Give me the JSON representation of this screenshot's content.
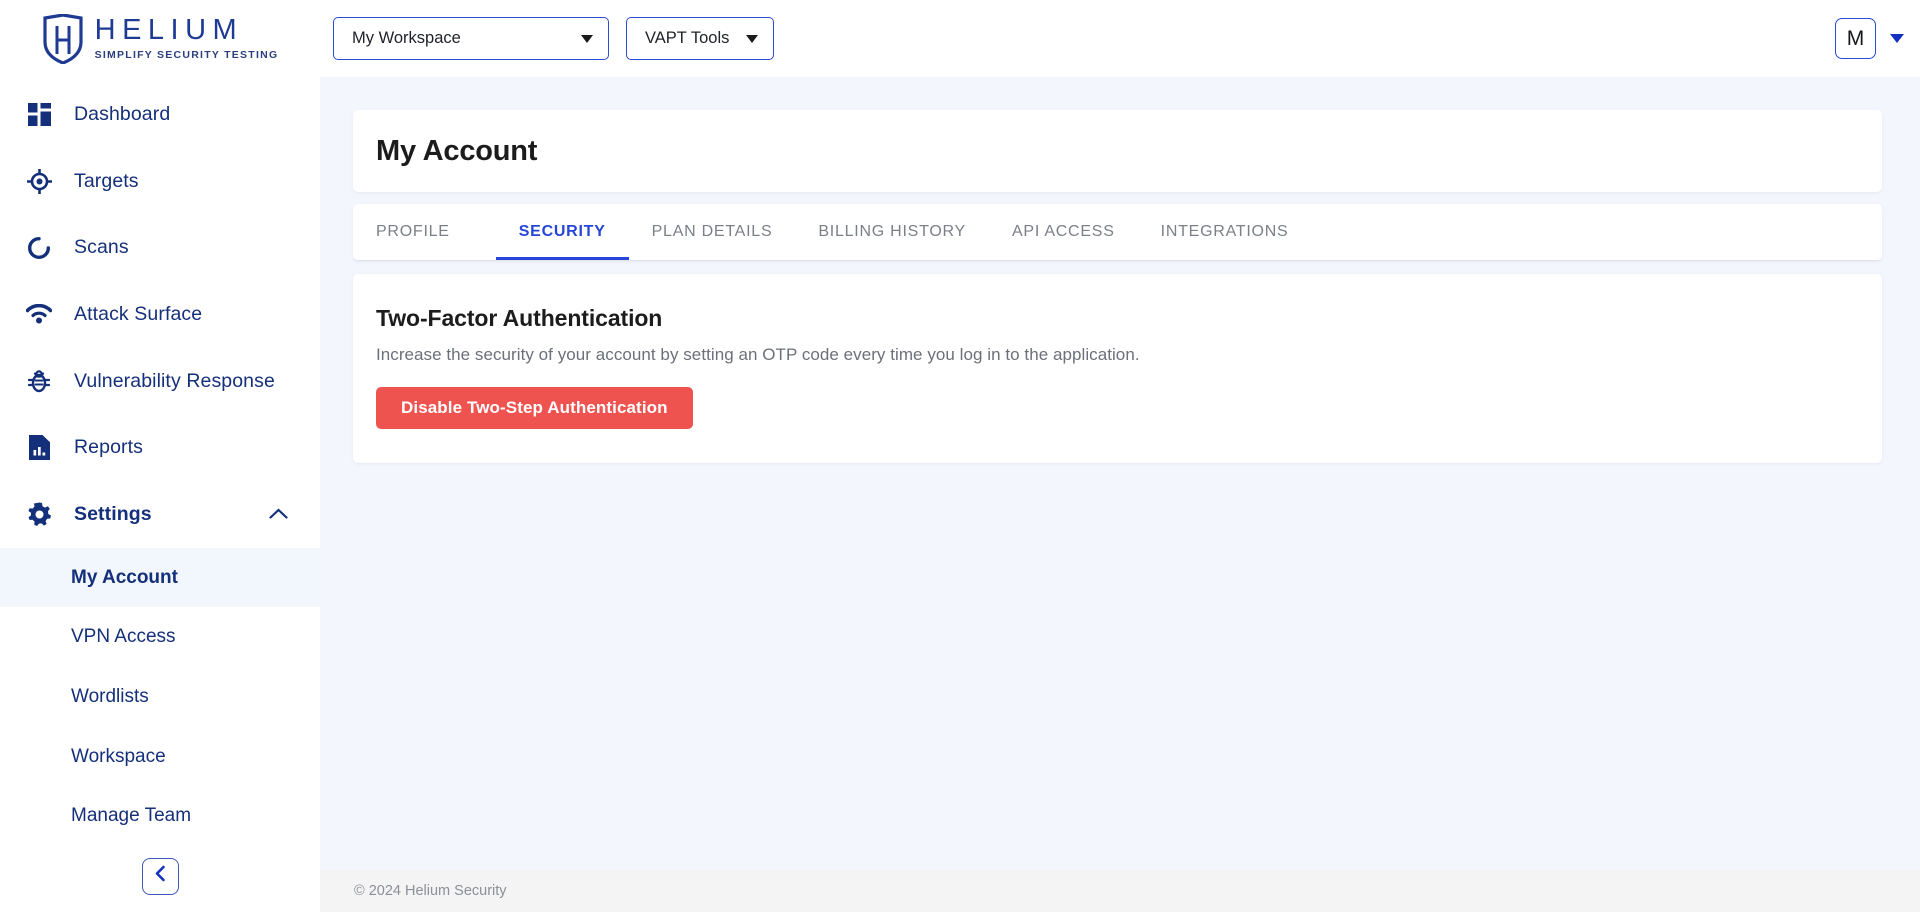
{
  "brand": {
    "name": "HELIUM",
    "tagline": "SIMPLIFY SECURITY TESTING",
    "logo_icon": "shield-h-icon",
    "primary_color": "#1f3a93",
    "accent_color": "#2546d8"
  },
  "topbar": {
    "workspace_dropdown": {
      "value": "My Workspace",
      "icon": "chevron-down-icon"
    },
    "tools_dropdown": {
      "value": "VAPT Tools",
      "icon": "chevron-down-icon"
    },
    "avatar": {
      "initial": "M",
      "icon": "chevron-down-icon"
    }
  },
  "sidebar": {
    "items": [
      {
        "label": "Dashboard",
        "icon": "dashboard-grid-icon",
        "active": false
      },
      {
        "label": "Targets",
        "icon": "target-crosshair-icon",
        "active": false
      },
      {
        "label": "Scans",
        "icon": "scan-spinner-icon",
        "active": false
      },
      {
        "label": "Attack Surface",
        "icon": "radar-wifi-icon",
        "active": false
      },
      {
        "label": "Vulnerability Response",
        "icon": "bug-icon",
        "active": false
      },
      {
        "label": "Reports",
        "icon": "report-document-icon",
        "active": false
      },
      {
        "label": "Settings",
        "icon": "gear-icon",
        "active": true,
        "expanded": true,
        "chevron": "chevron-up-icon"
      }
    ],
    "settings_children": [
      {
        "label": "My Account",
        "active": true
      },
      {
        "label": "VPN Access",
        "active": false
      },
      {
        "label": "Wordlists",
        "active": false
      },
      {
        "label": "Workspace",
        "active": false
      },
      {
        "label": "Manage Team",
        "active": false
      }
    ],
    "collapse_button": {
      "icon": "chevron-left-icon",
      "title": "Collapse sidebar"
    }
  },
  "main": {
    "page_title": "My Account",
    "tabs": [
      {
        "label": "PROFILE",
        "active": false
      },
      {
        "label": "SECURITY",
        "active": true
      },
      {
        "label": "PLAN DETAILS",
        "active": false
      },
      {
        "label": "BILLING HISTORY",
        "active": false
      },
      {
        "label": "API ACCESS",
        "active": false
      },
      {
        "label": "INTEGRATIONS",
        "active": false
      }
    ],
    "security": {
      "heading": "Two-Factor Authentication",
      "description": "Increase the security of your account by setting an OTP code every time you log in to the application.",
      "action_button": {
        "label": "Disable Two-Step Authentication",
        "color": "#ef5350"
      }
    }
  },
  "footer": {
    "copyright": "© 2024 Helium Security"
  }
}
